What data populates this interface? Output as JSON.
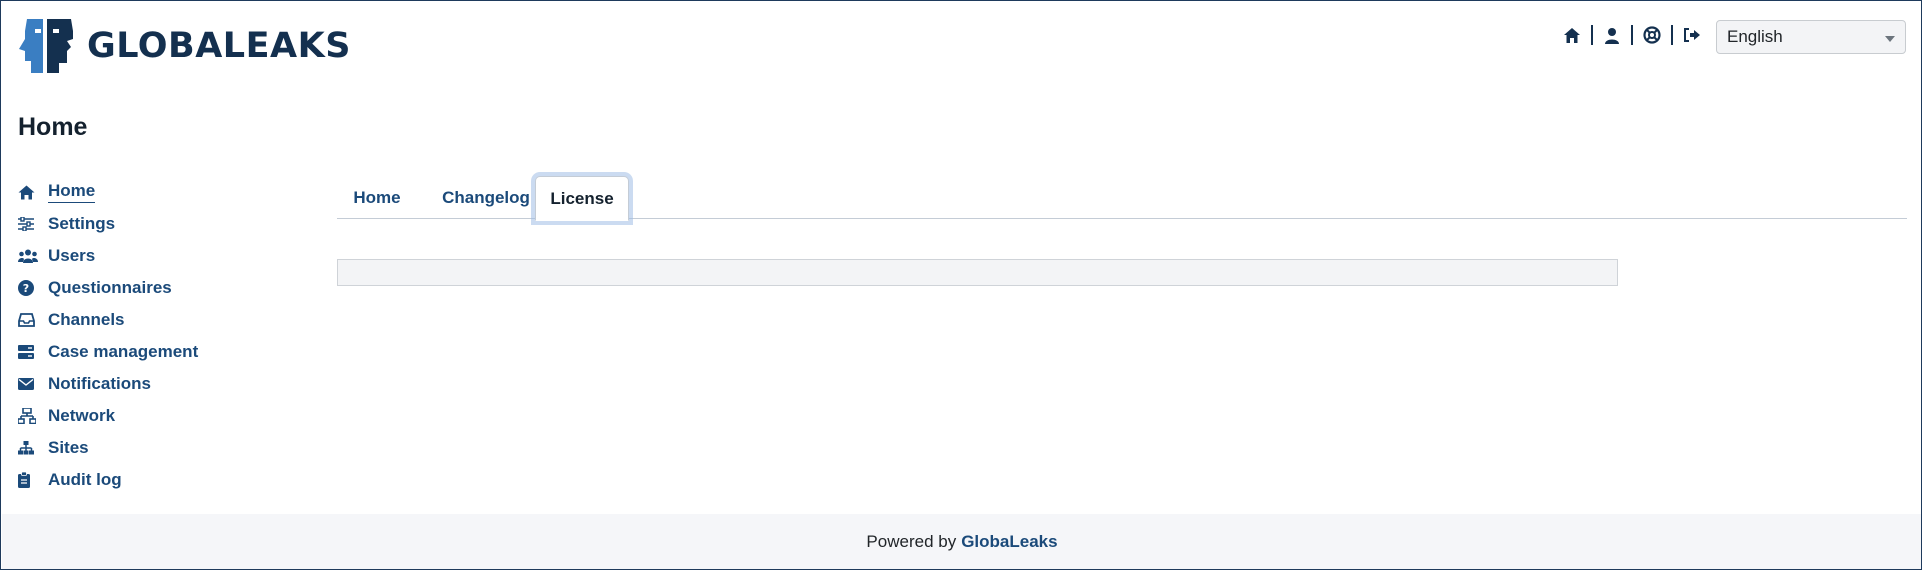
{
  "brand": {
    "name": "GLOBALEAKS",
    "logo_icon": "globaleaks-faces-logo"
  },
  "header": {
    "icons": [
      {
        "name": "home-icon"
      },
      {
        "name": "user-icon"
      },
      {
        "name": "help-lifebuoy-icon"
      },
      {
        "name": "logout-icon"
      }
    ],
    "language": {
      "selected": "English"
    }
  },
  "page": {
    "title": "Home"
  },
  "sidebar": {
    "items": [
      {
        "label": "Home",
        "icon": "home-icon",
        "active": true
      },
      {
        "label": "Settings",
        "icon": "sliders-icon"
      },
      {
        "label": "Users",
        "icon": "users-icon"
      },
      {
        "label": "Questionnaires",
        "icon": "question-circle-icon"
      },
      {
        "label": "Channels",
        "icon": "inbox-icon"
      },
      {
        "label": "Case management",
        "icon": "server-icon"
      },
      {
        "label": "Notifications",
        "icon": "envelope-icon"
      },
      {
        "label": "Network",
        "icon": "network-icon"
      },
      {
        "label": "Sites",
        "icon": "sitemap-icon"
      },
      {
        "label": "Audit log",
        "icon": "clipboard-icon"
      }
    ]
  },
  "tabs": [
    {
      "label": "Home"
    },
    {
      "label": "Changelog"
    },
    {
      "label": "License",
      "active": true
    }
  ],
  "footer": {
    "prefix": "Powered by",
    "link": "GlobaLeaks"
  },
  "colors": {
    "accent": "#1b4a7a",
    "dark": "#14304f",
    "footer_bg": "#f5f6f9"
  }
}
